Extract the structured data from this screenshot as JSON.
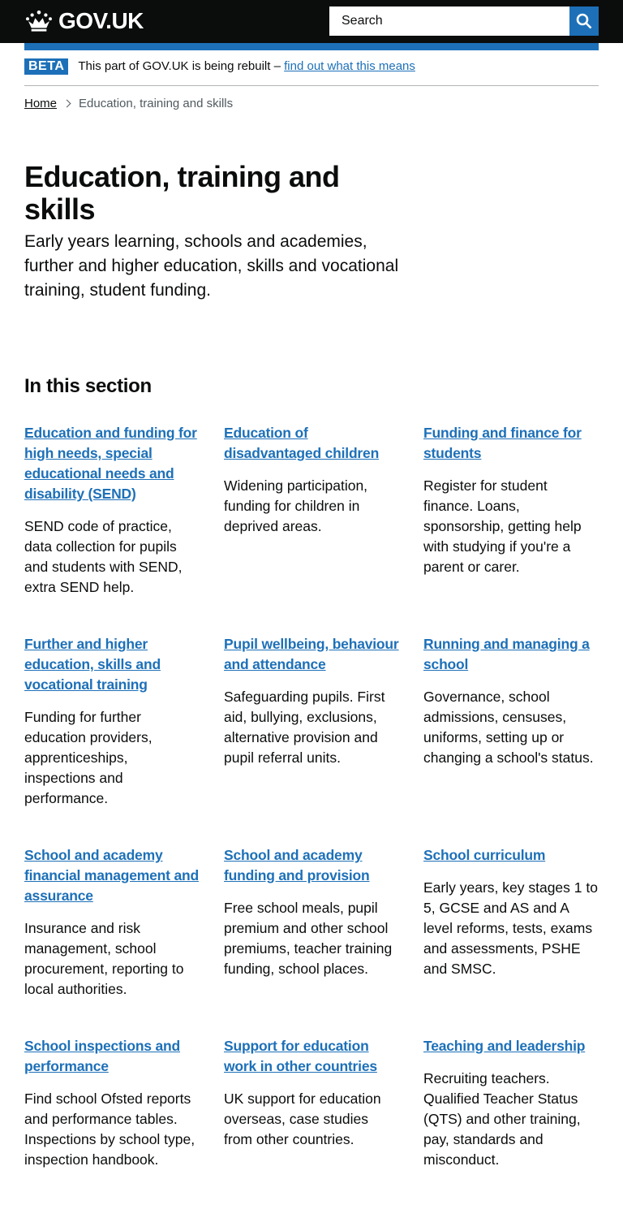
{
  "header": {
    "logo_text": "GOV.UK",
    "search_placeholder": "Search"
  },
  "phase_banner": {
    "tag": "BETA",
    "text": "This part of GOV.UK is being rebuilt –",
    "link": "find out what this means"
  },
  "breadcrumbs": {
    "home": "Home",
    "current": "Education, training and skills"
  },
  "page": {
    "title": "Education, training and skills",
    "description": "Early years learning, schools and academies, further and higher education, skills and vocational training, student funding."
  },
  "section": {
    "heading": "In this section",
    "items": [
      {
        "title": "Education and funding for high needs, special educational needs and disability (SEND)",
        "description": "SEND code of practice, data collection for pupils and students with SEND, extra SEND help."
      },
      {
        "title": "Education of disadvantaged children",
        "description": "Widening participation, funding for children in deprived areas."
      },
      {
        "title": "Funding and finance for students",
        "description": "Register for student finance. Loans, sponsorship, getting help with studying if you're a parent or carer."
      },
      {
        "title": "Further and higher education, skills and vocational training",
        "description": "Funding for further education providers, apprenticeships, inspections and performance."
      },
      {
        "title": "Pupil wellbeing, behaviour and attendance",
        "description": "Safeguarding pupils. First aid, bullying, exclusions, alternative provision and pupil referral units."
      },
      {
        "title": "Running and managing a school",
        "description": "Governance, school admissions, censuses, uniforms, setting up or changing a school's status."
      },
      {
        "title": "School and academy financial management and assurance",
        "description": "Insurance and risk management, school procurement, reporting to local authorities."
      },
      {
        "title": "School and academy funding and provision",
        "description": "Free school meals, pupil premium and other school premiums, teacher training funding, school places."
      },
      {
        "title": "School curriculum",
        "description": "Early years, key stages 1 to 5, GCSE and AS and A level reforms, tests, exams and assessments, PSHE and SMSC."
      },
      {
        "title": "School inspections and performance",
        "description": "Find school Ofsted reports and performance tables. Inspections by school type, inspection handbook."
      },
      {
        "title": "Support for education work in other countries",
        "description": "UK support for education overseas, case studies from other countries."
      },
      {
        "title": "Teaching and leadership",
        "description": "Recruiting teachers. Qualified Teacher Status (QTS) and other training, pay, standards and misconduct."
      }
    ]
  },
  "colors": {
    "header_bg": "#0b0c0c",
    "brand_blue": "#1d70b8",
    "text": "#0b0c0c",
    "secondary_text": "#505a5f"
  },
  "icons": {
    "logo": "crown-icon",
    "search": "search-icon",
    "breadcrumb_separator": "chevron-right-icon"
  }
}
